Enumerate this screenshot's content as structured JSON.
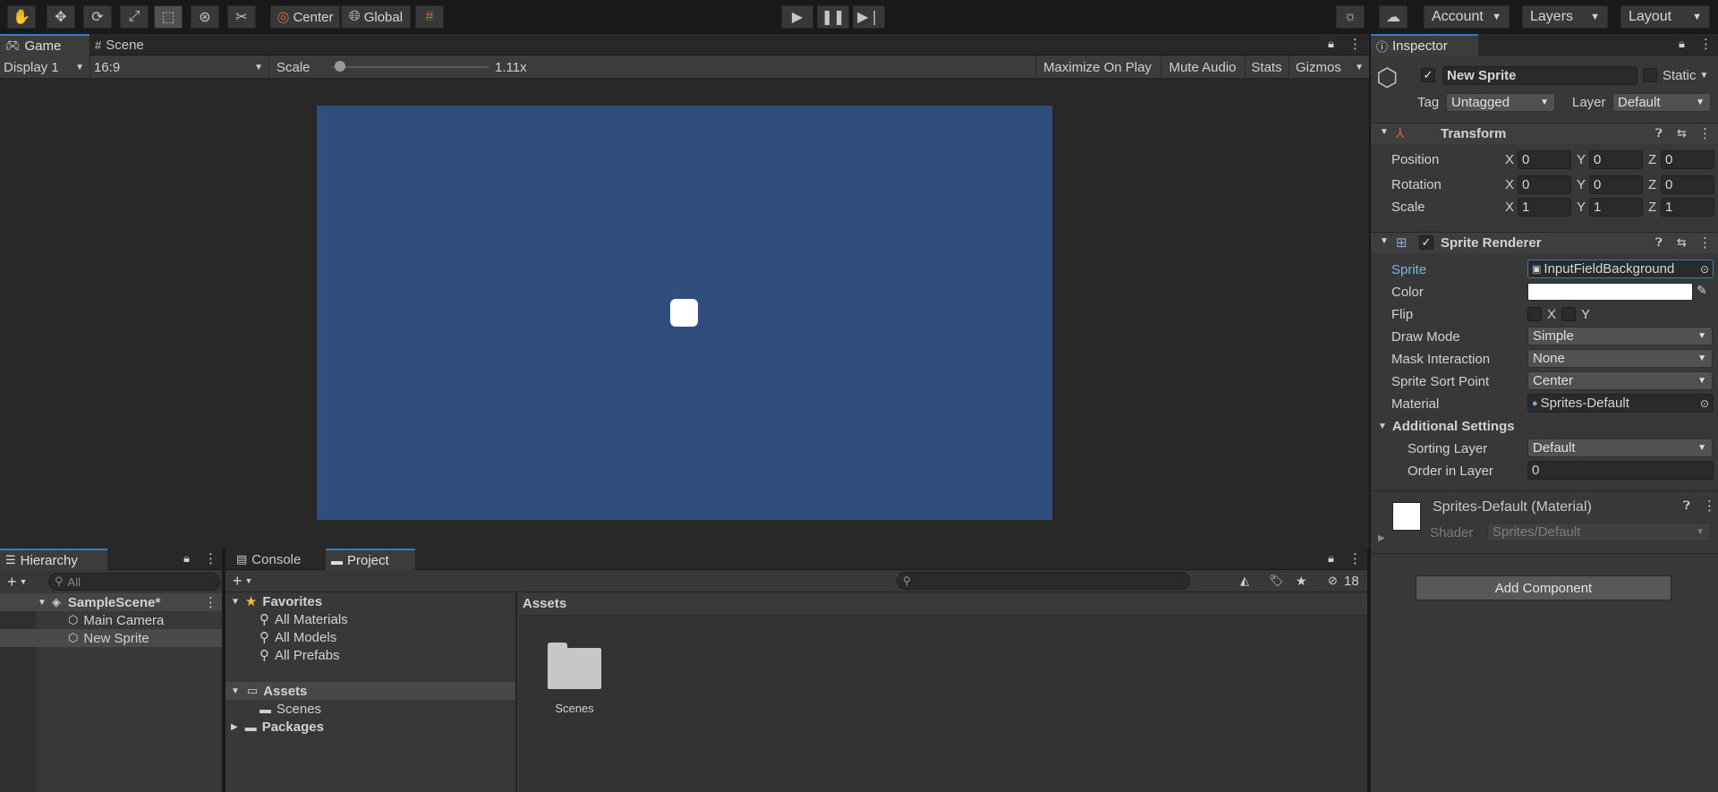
{
  "toolbar": {
    "tools": [
      "hand-tool",
      "move-tool",
      "rotate-tool",
      "scale-tool",
      "rect-tool",
      "transform-tool",
      "custom-tool"
    ],
    "pivot_label": "Center",
    "space_label": "Global",
    "account_label": "Account",
    "layers_label": "Layers",
    "layout_label": "Layout"
  },
  "game": {
    "tabs": [
      "Game",
      "Scene"
    ],
    "display": "Display 1",
    "aspect": "16:9",
    "scale_label": "Scale",
    "scale_value": "1.11x",
    "scale_fraction": 0.05,
    "buttons": [
      "Maximize On Play",
      "Mute Audio",
      "Stats",
      "Gizmos"
    ],
    "background_color": "#2f4e7d"
  },
  "hierarchy": {
    "tab": "Hierarchy",
    "search_placeholder": "All",
    "scene": "SampleScene*",
    "items": [
      "Main Camera",
      "New Sprite"
    ]
  },
  "project": {
    "tabs": [
      "Console",
      "Project"
    ],
    "hidden_count": "18",
    "favorites_label": "Favorites",
    "favorites": [
      "All Materials",
      "All Models",
      "All Prefabs"
    ],
    "assets_label": "Assets",
    "asset_folders": [
      "Scenes"
    ],
    "packages_label": "Packages",
    "breadcrumb": "Assets",
    "grid_items": [
      "Scenes"
    ]
  },
  "inspector": {
    "tab": "Inspector",
    "object_name": "New Sprite",
    "static_label": "Static",
    "tag_label": "Tag",
    "tag_value": "Untagged",
    "layer_label": "Layer",
    "layer_value": "Default",
    "transform": {
      "title": "Transform",
      "rows": [
        {
          "label": "Position",
          "x": "0",
          "y": "0",
          "z": "0"
        },
        {
          "label": "Rotation",
          "x": "0",
          "y": "0",
          "z": "0"
        },
        {
          "label": "Scale",
          "x": "1",
          "y": "1",
          "z": "1"
        }
      ]
    },
    "sprite_renderer": {
      "title": "Sprite Renderer",
      "sprite_label": "Sprite",
      "sprite_value": "InputFieldBackground",
      "color_label": "Color",
      "flip_label": "Flip",
      "flip_x": "X",
      "flip_y": "Y",
      "draw_mode_label": "Draw Mode",
      "draw_mode_value": "Simple",
      "mask_label": "Mask Interaction",
      "mask_value": "None",
      "sort_point_label": "Sprite Sort Point",
      "sort_point_value": "Center",
      "material_label": "Material",
      "material_value": "Sprites-Default",
      "additional_label": "Additional Settings",
      "sorting_layer_label": "Sorting Layer",
      "sorting_layer_value": "Default",
      "order_label": "Order in Layer",
      "order_value": "0"
    },
    "material": {
      "title": "Sprites-Default (Material)",
      "shader_label": "Shader",
      "shader_value": "Sprites/Default"
    },
    "add_component": "Add Component"
  }
}
